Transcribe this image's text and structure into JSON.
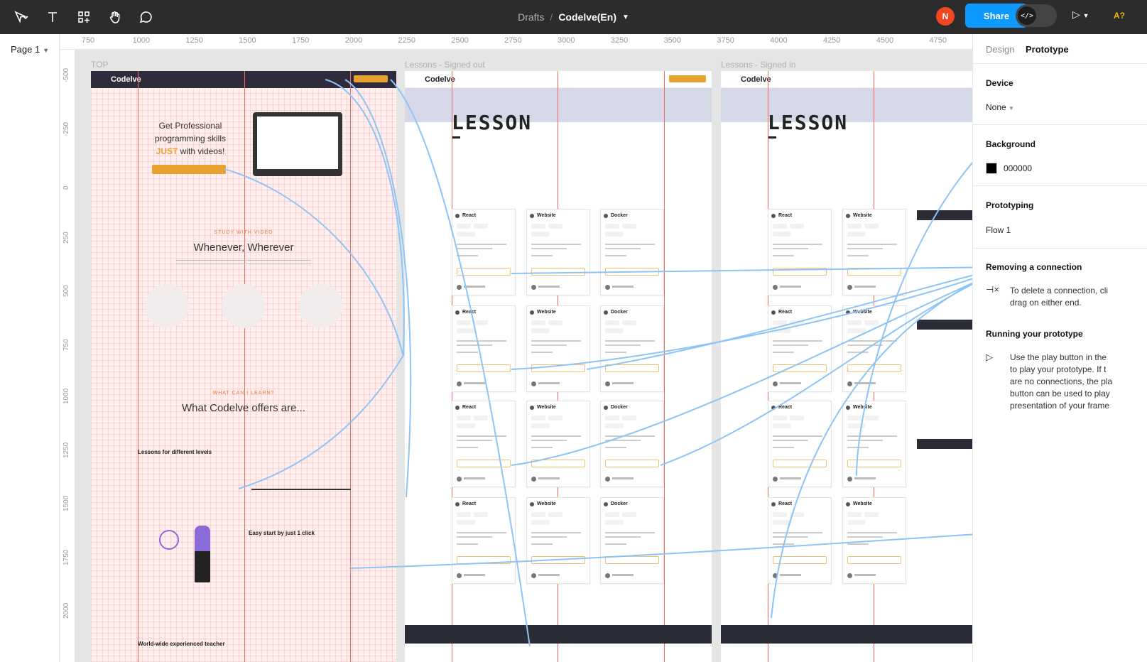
{
  "toolbar": {
    "tools": [
      "move-tool",
      "text-tool",
      "components-tool",
      "hand-tool",
      "comment-tool"
    ],
    "breadcrumb_drafts": "Drafts",
    "breadcrumb_sep": "/",
    "file_name": "Codelve(En)",
    "avatar_initial": "N",
    "share_label": "Share",
    "dev_mode_label": "</>",
    "play_label": "▷",
    "a11y_label": "A?"
  },
  "left_panel": {
    "page_label": "Page 1"
  },
  "ruler": {
    "h_ticks": [
      "750",
      "1000",
      "1250",
      "1500",
      "1750",
      "2000",
      "2250",
      "2500",
      "2750",
      "3000",
      "3250",
      "3500",
      "3750",
      "4000",
      "4250",
      "4500",
      "4750"
    ],
    "v_ticks": [
      "-500",
      "-250",
      "0",
      "250",
      "500",
      "750",
      "1000",
      "1250",
      "1500",
      "1750",
      "2000"
    ]
  },
  "frames": {
    "top": {
      "label": "TOP",
      "logo": "Codelve",
      "hero_line1": "Get Professional",
      "hero_line2": "programming skills",
      "hero_just": "JUST",
      "hero_line3_rest": " with videos!",
      "kicker1": "STUDY WITH VIDEO",
      "section1_title": "Whenever, Wherever",
      "kicker2": "WHAT CAN I LEARN?",
      "section2_title": "What Codelve offers are...",
      "lessons_heading": "Lessons for different levels",
      "easy_heading": "Easy start by just 1 click",
      "teacher_heading": "World-wide experienced teacher"
    },
    "signed_out": {
      "label": "Lessons - Signed out",
      "logo": "Codelve",
      "title": "LESSON"
    },
    "signed_in": {
      "label": "Lessons - Signed in",
      "logo": "Codelve",
      "title": "LESSON"
    },
    "card_titles": [
      "React",
      "Website",
      "Docker"
    ]
  },
  "right_panel": {
    "tab_design": "Design",
    "tab_prototype": "Prototype",
    "device_title": "Device",
    "device_value": "None",
    "background_title": "Background",
    "background_value": "000000",
    "background_color": "#000000",
    "prototyping_title": "Prototyping",
    "flow_name": "Flow 1",
    "removing_title": "Removing a connection",
    "removing_line1": "To delete a connection, cli",
    "removing_line2": "drag on either end.",
    "running_title": "Running your prototype",
    "running_line1": "Use the play button in the",
    "running_line2": "to play your prototype. If t",
    "running_line3": "are no connections, the pla",
    "running_line4": "button can be used to play",
    "running_line5": "presentation of your frame"
  },
  "colors": {
    "accent": "#0d99ff",
    "connection": "#8ec4f5",
    "grid": "#ee6a5a",
    "brand_orange": "#e8a030"
  }
}
